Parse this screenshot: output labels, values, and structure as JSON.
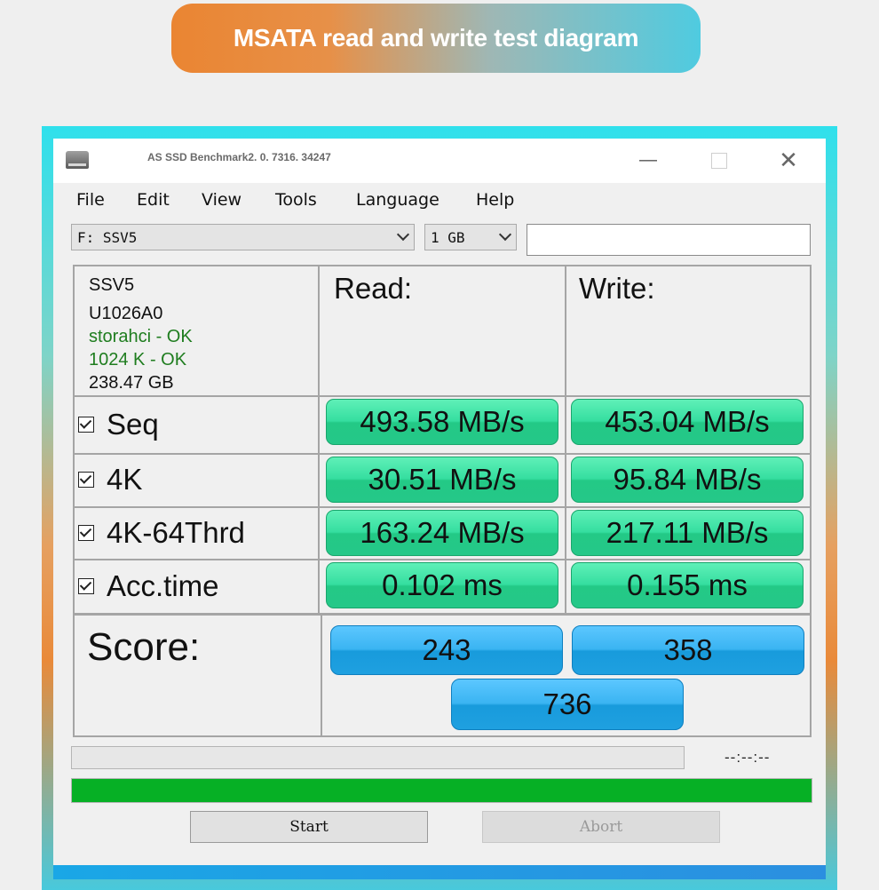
{
  "banner": {
    "title": "MSATA read and write test diagram"
  },
  "window": {
    "title": "AS SSD Benchmark2. 0. 7316. 34247",
    "minimize": "—",
    "close": "✕",
    "icon": "drive-icon"
  },
  "menu": {
    "items": [
      "File",
      "Edit",
      "View",
      "Tools",
      "Language",
      "Help"
    ]
  },
  "toolbar": {
    "drive": "F:  SSV5",
    "size": "1 GB",
    "textbox": ""
  },
  "device": {
    "name": "SSV5",
    "firmware": "U1026A0",
    "driver": "storahci - OK",
    "alignment": "1024 K - OK",
    "capacity": "238.47 GB"
  },
  "columns": {
    "read": "Read:",
    "write": "Write:"
  },
  "tests": [
    {
      "label": "Seq",
      "checked": true,
      "read": "493.58 MB/s",
      "write": "453.04 MB/s"
    },
    {
      "label": "4K",
      "checked": true,
      "read": "30.51 MB/s",
      "write": "95.84 MB/s"
    },
    {
      "label": "4K-64Thrd",
      "checked": true,
      "read": "163.24 MB/s",
      "write": "217.11 MB/s"
    },
    {
      "label": "Acc.time",
      "checked": true,
      "read": "0.102 ms",
      "write": "0.155 ms"
    }
  ],
  "score": {
    "label": "Score:",
    "read": "243",
    "write": "358",
    "total": "736"
  },
  "progress": {
    "timer": "--:--:--",
    "current_fraction": 0,
    "overall_fraction": 1.0,
    "bar_color": "#06b025"
  },
  "buttons": {
    "start": "Start",
    "abort": "Abort"
  },
  "colors": {
    "result_green": "#35dea0",
    "score_blue": "#3ab4f2",
    "ok_text": "#1f7d1f"
  }
}
